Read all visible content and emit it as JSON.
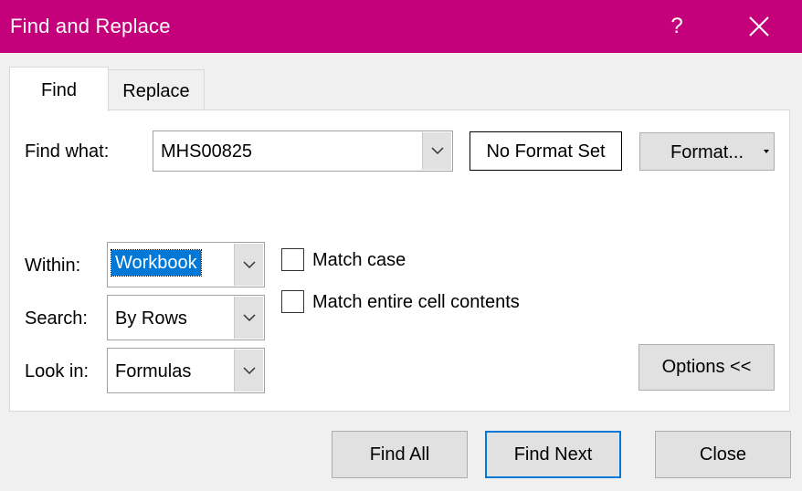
{
  "window": {
    "title": "Find and Replace",
    "help_label": "?",
    "accent_color": "#c4007a"
  },
  "tabs": [
    {
      "label": "Find",
      "active": true
    },
    {
      "label": "Replace",
      "active": false
    }
  ],
  "find": {
    "label": "Find what:",
    "value": "MHS00825",
    "format_status": "No Format Set",
    "format_button": "Format..."
  },
  "options": {
    "within": {
      "label": "Within:",
      "value": "Workbook"
    },
    "search": {
      "label": "Search:",
      "value": "By Rows"
    },
    "look_in": {
      "label": "Look in:",
      "value": "Formulas"
    },
    "match_case": {
      "label": "Match case",
      "checked": false
    },
    "match_entire": {
      "label": "Match entire cell contents",
      "checked": false
    },
    "options_button": "Options <<"
  },
  "buttons": {
    "find_all": "Find All",
    "find_next": "Find Next",
    "close": "Close"
  }
}
